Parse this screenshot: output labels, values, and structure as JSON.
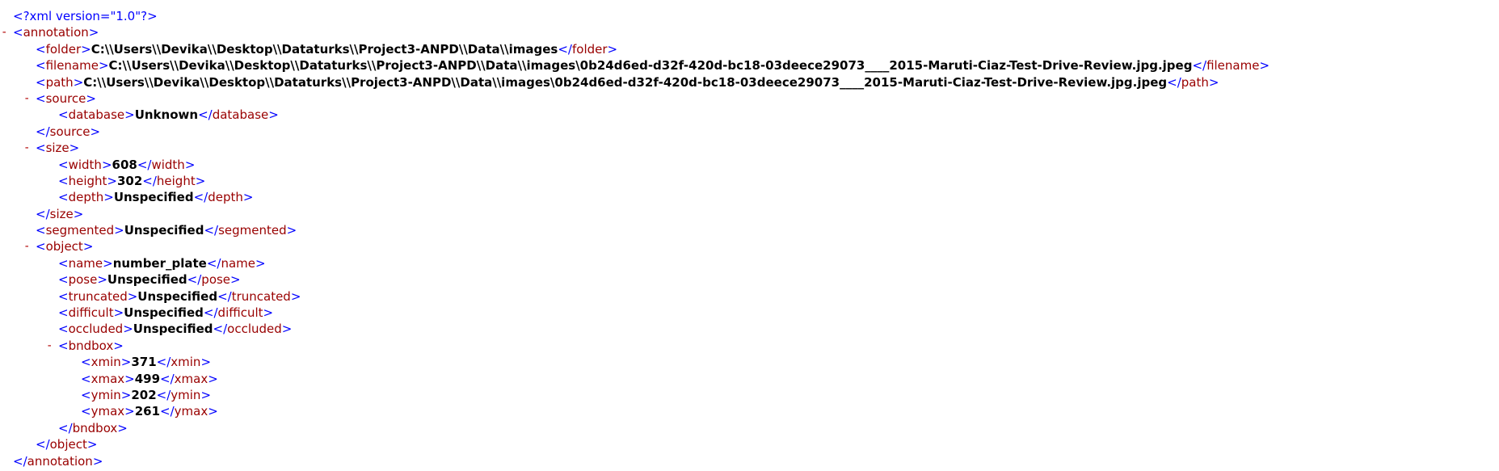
{
  "declaration": "<?xml version=\"1.0\"?>",
  "toggle_symbol": "-",
  "colors": {
    "bracket": "#0000ff",
    "tag_name": "#990000",
    "toggle": "#b00000",
    "value": "#000000"
  },
  "lines": [
    {
      "kind": "open",
      "tag": "annotation",
      "depth": 0,
      "collapsible": true
    },
    {
      "kind": "leaf",
      "tag": "folder",
      "value": "C:\\\\Users\\\\Devika\\\\Desktop\\\\Dataturks\\\\Project3-ANPD\\\\Data\\\\images",
      "depth": 1
    },
    {
      "kind": "leaf",
      "tag": "filename",
      "value": "C:\\\\Users\\\\Devika\\\\Desktop\\\\Dataturks\\\\Project3-ANPD\\\\Data\\\\images\\0b24d6ed-d32f-420d-bc18-03deece29073____2015-Maruti-Ciaz-Test-Drive-Review.jpg.jpeg",
      "depth": 1
    },
    {
      "kind": "leaf",
      "tag": "path",
      "value": "C:\\\\Users\\\\Devika\\\\Desktop\\\\Dataturks\\\\Project3-ANPD\\\\Data\\\\images\\0b24d6ed-d32f-420d-bc18-03deece29073____2015-Maruti-Ciaz-Test-Drive-Review.jpg.jpeg",
      "depth": 1
    },
    {
      "kind": "open",
      "tag": "source",
      "depth": 1,
      "collapsible": true
    },
    {
      "kind": "leaf",
      "tag": "database",
      "value": "Unknown",
      "depth": 2
    },
    {
      "kind": "close",
      "tag": "source",
      "depth": 1
    },
    {
      "kind": "open",
      "tag": "size",
      "depth": 1,
      "collapsible": true
    },
    {
      "kind": "leaf",
      "tag": "width",
      "value": "608",
      "depth": 2
    },
    {
      "kind": "leaf",
      "tag": "height",
      "value": "302",
      "depth": 2
    },
    {
      "kind": "leaf",
      "tag": "depth",
      "value": "Unspecified",
      "depth": 2
    },
    {
      "kind": "close",
      "tag": "size",
      "depth": 1
    },
    {
      "kind": "leaf",
      "tag": "segmented",
      "value": "Unspecified",
      "depth": 1
    },
    {
      "kind": "open",
      "tag": "object",
      "depth": 1,
      "collapsible": true
    },
    {
      "kind": "leaf",
      "tag": "name",
      "value": "number_plate",
      "depth": 2
    },
    {
      "kind": "leaf",
      "tag": "pose",
      "value": "Unspecified",
      "depth": 2
    },
    {
      "kind": "leaf",
      "tag": "truncated",
      "value": "Unspecified",
      "depth": 2
    },
    {
      "kind": "leaf",
      "tag": "difficult",
      "value": "Unspecified",
      "depth": 2
    },
    {
      "kind": "leaf",
      "tag": "occluded",
      "value": "Unspecified",
      "depth": 2
    },
    {
      "kind": "open",
      "tag": "bndbox",
      "depth": 2,
      "collapsible": true
    },
    {
      "kind": "leaf",
      "tag": "xmin",
      "value": "371",
      "depth": 3
    },
    {
      "kind": "leaf",
      "tag": "xmax",
      "value": "499",
      "depth": 3
    },
    {
      "kind": "leaf",
      "tag": "ymin",
      "value": "202",
      "depth": 3
    },
    {
      "kind": "leaf",
      "tag": "ymax",
      "value": "261",
      "depth": 3
    },
    {
      "kind": "close",
      "tag": "bndbox",
      "depth": 2
    },
    {
      "kind": "close",
      "tag": "object",
      "depth": 1
    },
    {
      "kind": "close",
      "tag": "annotation",
      "depth": 0
    }
  ]
}
